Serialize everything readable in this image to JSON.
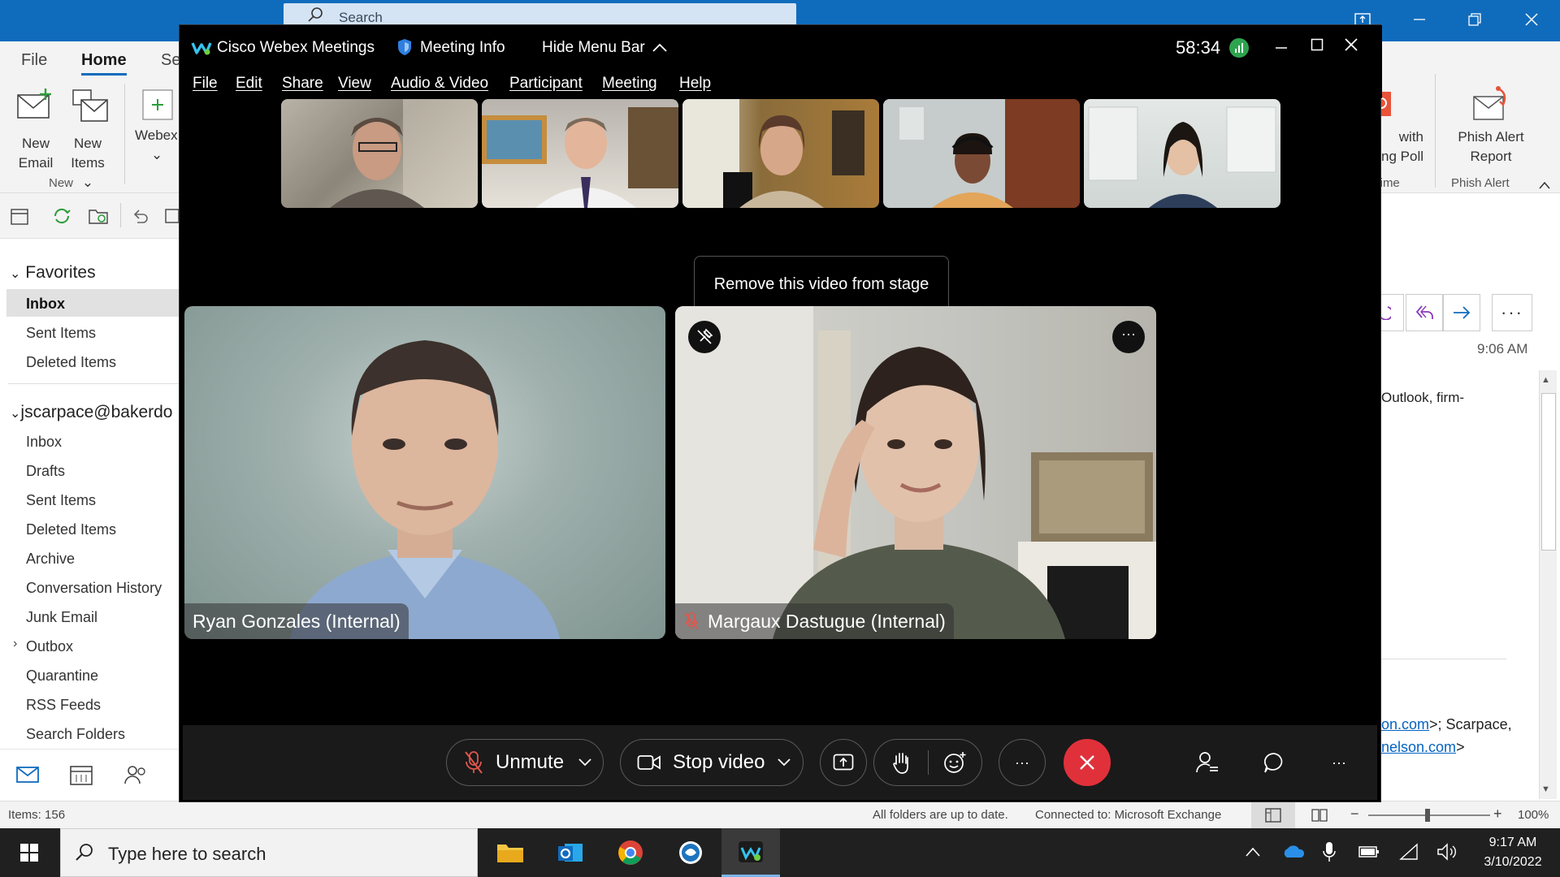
{
  "outlook": {
    "search_placeholder": "Search",
    "tabs": [
      "File",
      "Home",
      "Se"
    ],
    "ribbon": {
      "new_email": [
        "New",
        "Email"
      ],
      "new_items": [
        "New",
        "Items"
      ],
      "webex": "Webex",
      "group_new": "New",
      "poll_partial": [
        "with",
        "ng Poll"
      ],
      "poll_group_partial": "Time",
      "phish": [
        "Phish Alert",
        "Report"
      ],
      "phish_group": "Phish Alert"
    },
    "favorites_header": "Favorites",
    "favorites": [
      "Inbox",
      "Sent Items",
      "Deleted Items"
    ],
    "account_header": "jscarpace@bakerdo",
    "folders": [
      "Inbox",
      "Drafts",
      "Sent Items",
      "Deleted Items",
      "Archive",
      "Conversation History",
      "Junk Email",
      "Outbox",
      "Quarantine",
      "RSS Feeds",
      "Search Folders"
    ],
    "reading": {
      "time": "9:06 AM",
      "snippet": "Outlook, firm-",
      "link1": "on.com",
      "link1_suffix": ">; Scarpace,",
      "link2": "nelson.com",
      "link2_suffix": ">"
    },
    "status": {
      "items": "Items: 156",
      "sync": "All folders are up to date.",
      "connection": "Connected to: Microsoft Exchange",
      "zoom": "100%"
    }
  },
  "webex": {
    "app_name": "Cisco Webex Meetings",
    "meeting_info": "Meeting Info",
    "hide_menu": "Hide Menu Bar",
    "timer": "58:34",
    "menu": [
      "File",
      "Edit",
      "Share",
      "View",
      "Audio & Video",
      "Participant",
      "Meeting",
      "Help"
    ],
    "tooltip": "Remove this video from stage",
    "stage": [
      {
        "name": "Ryan Gonzales (Internal)"
      },
      {
        "name": "Margaux Dastugue (Internal)"
      }
    ],
    "controls": {
      "unmute": "Unmute",
      "stop_video": "Stop video"
    }
  },
  "taskbar": {
    "search_placeholder": "Type here to search",
    "time": "9:17 AM",
    "date": "3/10/2022"
  }
}
